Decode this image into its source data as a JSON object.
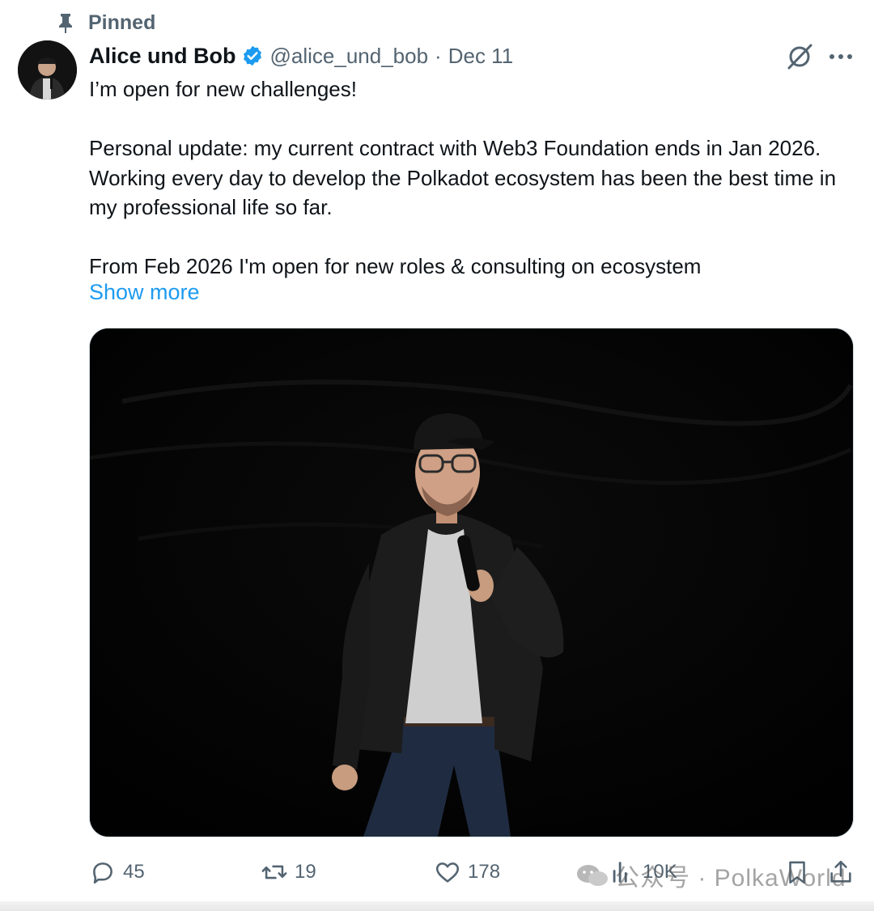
{
  "pinned": {
    "label": "Pinned",
    "icon": "pin-icon"
  },
  "author": {
    "display_name": "Alice und Bob",
    "handle": "@alice_und_bob",
    "separator": "·",
    "date": "Dec 11",
    "verified_color": "#1d9bf0"
  },
  "tweet": {
    "paragraphs": [
      "I’m open for new challenges!",
      "Personal update: my current contract with Web3 Foundation ends in Jan 2026. Working every day to develop the Polkadot ecosystem has been the best time in my professional life so far.",
      "From Feb 2026 I'm open for new roles & consulting on ecosystem"
    ],
    "show_more": "Show more"
  },
  "actions": {
    "replies": {
      "icon": "reply-icon",
      "count": "45"
    },
    "reposts": {
      "icon": "repost-icon",
      "count": "19"
    },
    "likes": {
      "icon": "heart-icon",
      "count": "178"
    },
    "views": {
      "icon": "views-icon",
      "count": "10K"
    },
    "bookmark": {
      "icon": "bookmark-icon"
    },
    "share": {
      "icon": "share-icon"
    }
  },
  "watermark": {
    "text": "公众号 · PolkaWorld"
  },
  "colors": {
    "text": "#0f1419",
    "secondary": "#536471",
    "accent": "#1d9bf0"
  }
}
